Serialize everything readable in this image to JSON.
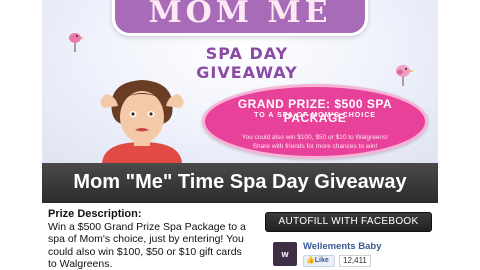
{
  "banner": {
    "title": "MOM ME TIME",
    "subtitle": "SPA DAY GIVEAWAY",
    "grand_prize": "GRAND PRIZE: $500 SPA PACKAGE",
    "grand_prize_sub": "TO A SPA OF MOM'S CHOICE",
    "line1": "You could also win $100, $50 or $10 to Walgreens!",
    "line2": "Share with friends for more chances to win!"
  },
  "titlebar": {
    "text": "Mom \"Me\" Time Spa Day Giveaway"
  },
  "prize": {
    "heading": "Prize Description:",
    "body": "Win a $500 Grand Prize Spa Package to a spa of Mom's choice, just by entering! You could also win $100, $50 or $10 gift cards to Walgreens."
  },
  "facebook": {
    "autofill_label": "AUTOFILL WITH FACEBOOK",
    "page_name": "Wellements Baby",
    "avatar_text": "w",
    "like_label": "Like",
    "like_count": "12,411"
  },
  "colors": {
    "purple": "#a86bb8",
    "pink": "#e8419a",
    "dark": "#2b2b2b",
    "fb_blue": "#3b5998"
  }
}
